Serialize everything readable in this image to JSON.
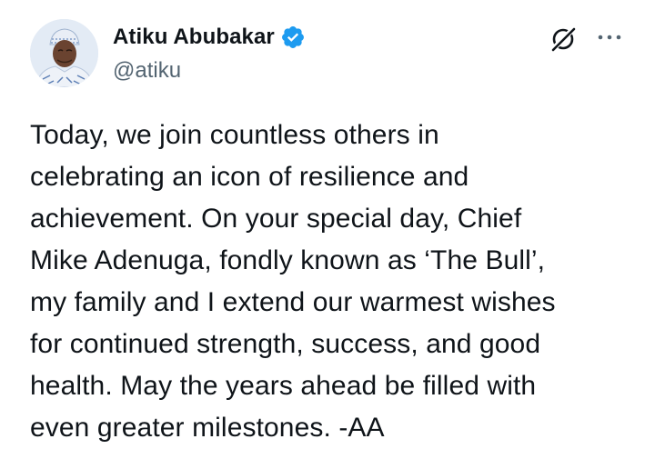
{
  "author": {
    "display_name": "Atiku Abubakar",
    "handle": "@atiku",
    "verified": true,
    "avatar": "profile-photo"
  },
  "actions": {
    "grok_icon": "grok-icon",
    "more_icon": "more-options-icon"
  },
  "post": {
    "text": "Today, we join countless others in\ncelebrating an icon of resilience and\nachievement. On your special day, Chief\nMike Adenuga, fondly known as ‘The Bull’,\nmy family and I extend our warmest wishes\nfor continued strength, success, and good\nhealth. May the years ahead be filled with\neven greater milestones. -AA"
  },
  "colors": {
    "text": "#0f1419",
    "secondary": "#536471",
    "verified": "#1d9bf0",
    "background": "#ffffff"
  }
}
